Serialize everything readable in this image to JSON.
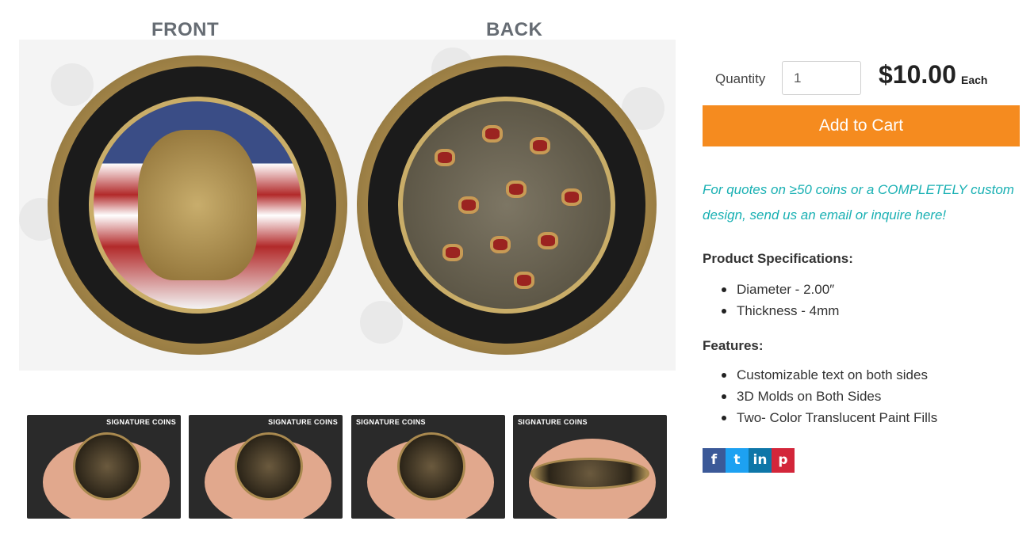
{
  "gallery": {
    "front_label": "FRONT",
    "back_label": "BACK",
    "thumbnail_brand": "SIGNATURE COINS"
  },
  "purchase": {
    "quantity_label": "Quantity",
    "quantity_value": "1",
    "price": "$10.00",
    "price_unit": "Each",
    "add_to_cart_label": "Add to Cart",
    "accent_color": "#f58b1f"
  },
  "quote": {
    "text": "For quotes on ≥50 coins or a COMPLETELY custom design, send us an email or inquire here!",
    "color": "#19b0b3"
  },
  "specifications": {
    "heading": "Product Specifications:",
    "items": [
      "Diameter - 2.00″",
      "Thickness - 4mm"
    ]
  },
  "features": {
    "heading": "Features:",
    "items": [
      "Customizable text on both sides",
      "3D Molds on Both Sides",
      "Two- Color Translucent Paint Fills"
    ]
  },
  "share": {
    "facebook_glyph": "f",
    "twitter_glyph": "t",
    "linkedin_glyph": "in",
    "pinterest_glyph": "p"
  }
}
